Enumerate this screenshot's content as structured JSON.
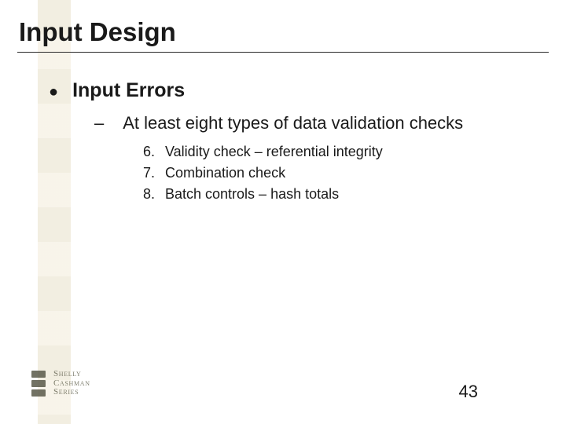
{
  "title": "Input Design",
  "bullet": {
    "marker": "●",
    "text": "Input Errors",
    "sub": {
      "marker": "–",
      "text": "At least eight types of data validation checks",
      "items": [
        {
          "n": "6.",
          "t": "Validity check – referential integrity"
        },
        {
          "n": "7.",
          "t": "Combination check"
        },
        {
          "n": "8.",
          "t": "Batch controls – hash totals"
        }
      ]
    }
  },
  "logo": {
    "line1": "Shelly",
    "line2": "Cashman",
    "line3": "Series"
  },
  "page": "43"
}
